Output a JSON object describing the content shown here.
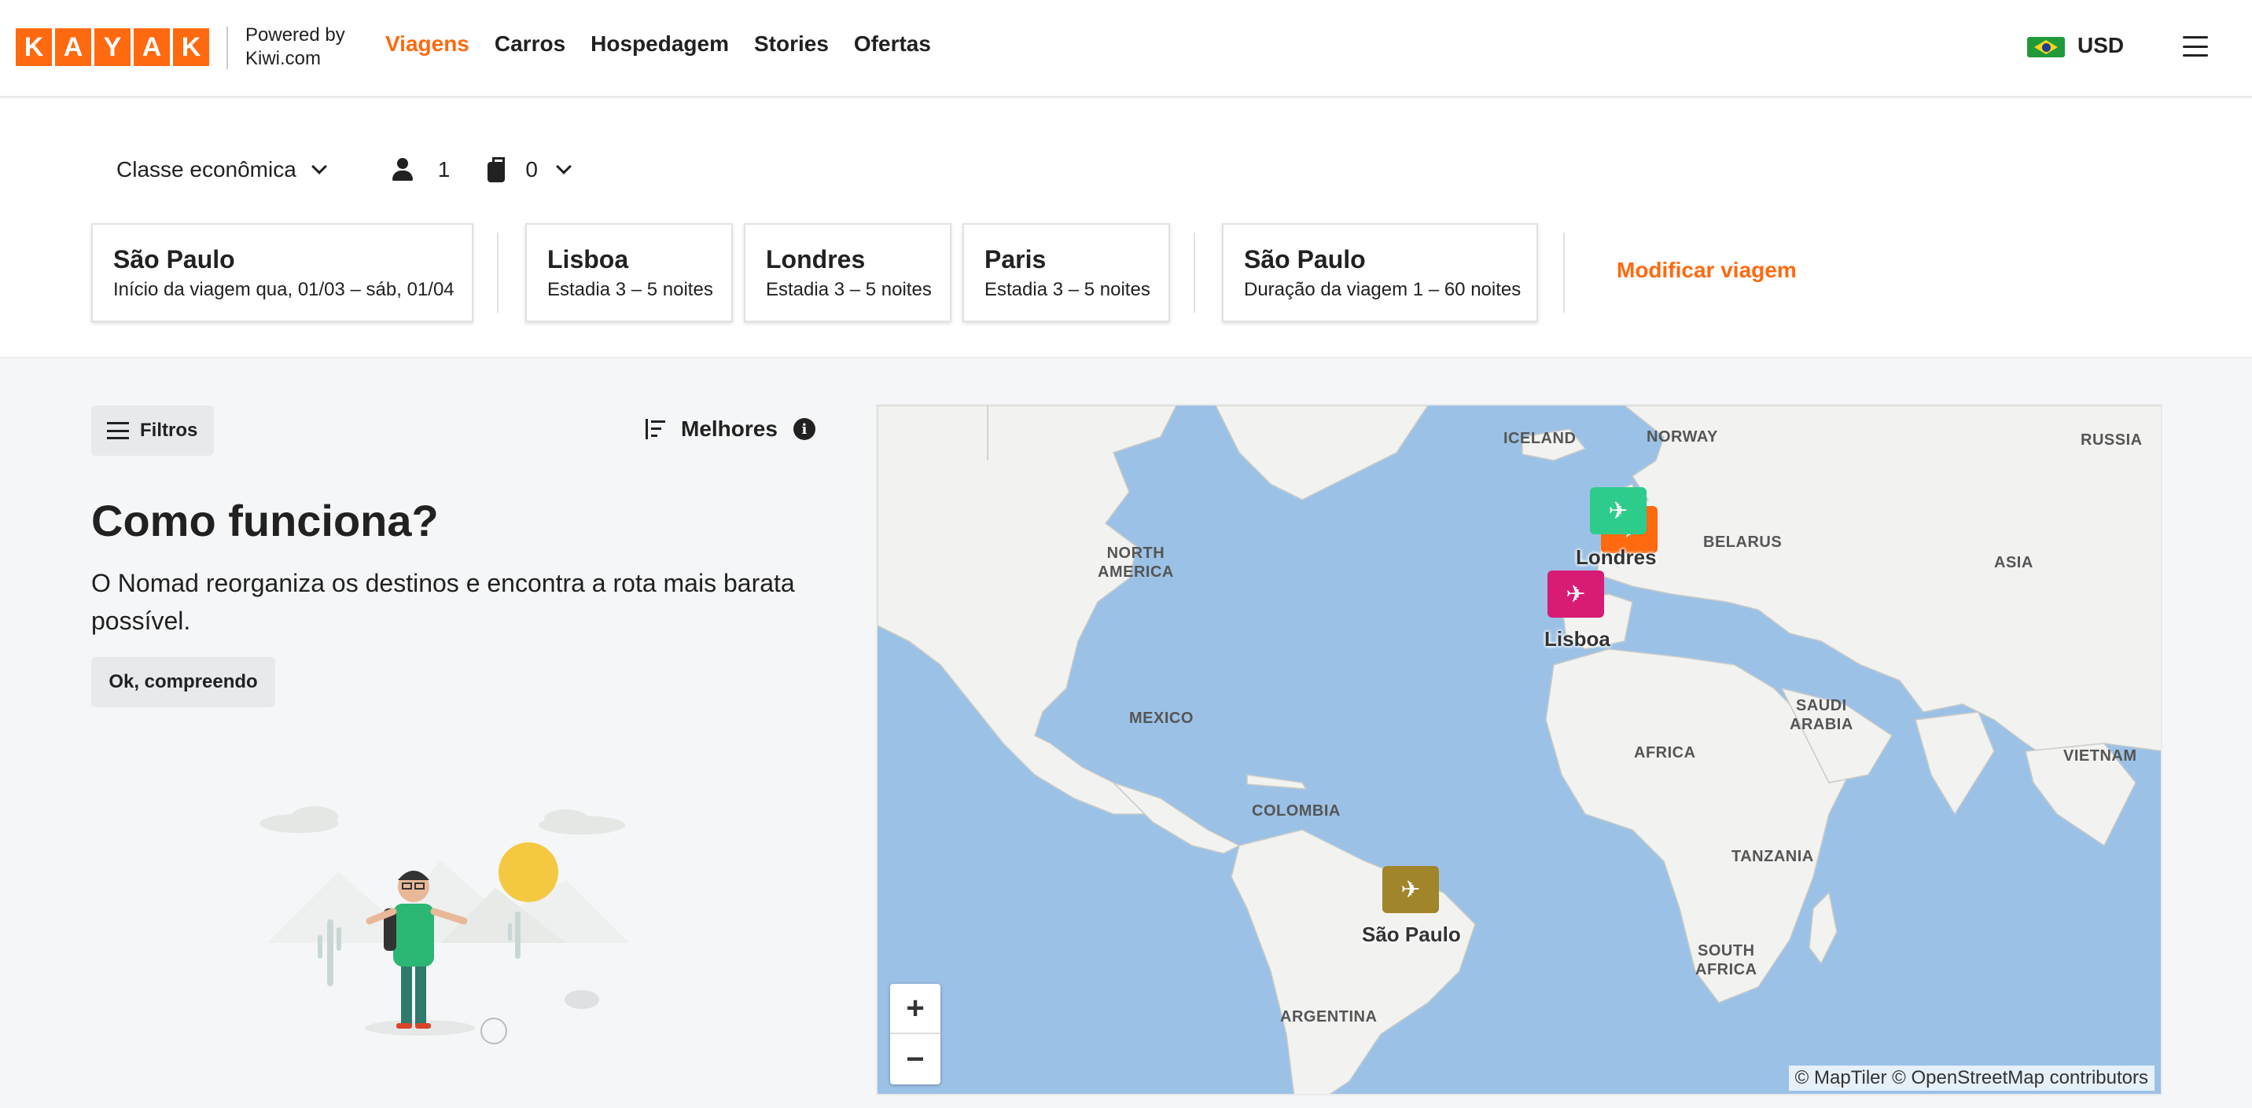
{
  "header": {
    "logo_letters": [
      "K",
      "A",
      "Y",
      "A",
      "K"
    ],
    "powered_line1": "Powered by",
    "powered_line2": "Kiwi.com",
    "nav": [
      {
        "label": "Viagens",
        "active": true
      },
      {
        "label": "Carros",
        "active": false
      },
      {
        "label": "Hospedagem",
        "active": false
      },
      {
        "label": "Stories",
        "active": false
      },
      {
        "label": "Ofertas",
        "active": false
      }
    ],
    "currency": "USD",
    "flag_icon": "brazil-flag-icon",
    "menu_icon": "hamburger-menu-icon"
  },
  "search": {
    "cabin_class": "Classe econômica",
    "passengers": "1",
    "bags": "0",
    "stops": [
      {
        "city": "São Paulo",
        "label": "Início da viagem",
        "detail": "qua, 01/03 – sáb, 01/04"
      },
      {
        "city": "Lisboa",
        "label": "Estadia",
        "detail": "3 – 5 noites"
      },
      {
        "city": "Londres",
        "label": "Estadia",
        "detail": "3 – 5 noites"
      },
      {
        "city": "Paris",
        "label": "Estadia",
        "detail": "3 – 5 noites"
      },
      {
        "city": "São Paulo",
        "label": "Duração da viagem",
        "detail": "1 – 60 noites"
      }
    ],
    "modify_label": "Modificar viagem"
  },
  "left_panel": {
    "filters_label": "Filtros",
    "sort_label": "Melhores",
    "how_title": "Como funciona?",
    "how_text": "O Nomad reorganiza os destinos e encontra a rota mais barata possível.",
    "ok_button": "Ok, compreendo"
  },
  "map": {
    "labels": {
      "iceland": "ICELAND",
      "norway": "NORWAY",
      "russia": "RUSSIA",
      "north_america_1": "NORTH",
      "north_america_2": "AMERICA",
      "belarus": "BELARUS",
      "asia": "ASIA",
      "mexico": "MEXICO",
      "saudi_1": "SAUDI",
      "saudi_2": "ARABIA",
      "africa": "AFRICA",
      "vietnam": "VIETNAM",
      "colombia": "COLOMBIA",
      "tanzania": "TANZANIA",
      "south_africa_1": "SOUTH",
      "south_africa_2": "AFRICA",
      "argentina": "ARGENTINA"
    },
    "pins": [
      {
        "city": "Londres",
        "color": "#ff690f"
      },
      {
        "city": "Paris",
        "color": "#2ecc8a"
      },
      {
        "city": "Lisboa",
        "color": "#d81b74"
      },
      {
        "city": "São Paulo",
        "color": "#a0852a"
      }
    ],
    "pin_labels": {
      "londres": "Londres",
      "lisboa": "Lisboa",
      "sao_paulo": "São Paulo"
    },
    "zoom_in": "+",
    "zoom_out": "−",
    "attribution": "© MapTiler © OpenStreetMap contributors"
  },
  "colors": {
    "accent": "#ff690f",
    "ocean": "#9cc1e6",
    "land": "#f2f3f1"
  }
}
